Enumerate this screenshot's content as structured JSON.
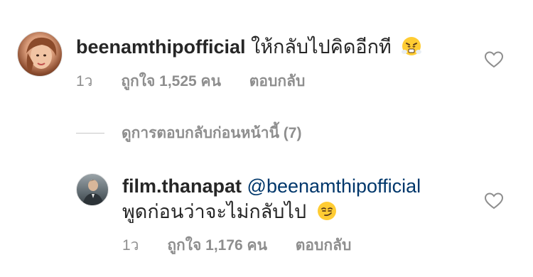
{
  "comment": {
    "username": "beenamthipofficial",
    "text": "ให้กลับไปคิดอีกที",
    "emoji": "face-with-steam-emoji",
    "time": "1ว",
    "likes": "ถูกใจ 1,525 คน",
    "reply_label": "ตอบกลับ"
  },
  "view_replies": {
    "label": "ดูการตอบกลับก่อนหน้านี้ (7)"
  },
  "reply": {
    "username": "film.thanapat",
    "mention": "@beenamthipofficial",
    "text": "พูดก่อนว่าจะไม่กลับไป",
    "emoji": "smirking-face-emoji",
    "time": "1ว",
    "likes": "ถูกใจ 1,176 คน",
    "reply_label": "ตอบกลับ"
  },
  "colors": {
    "text": "#262626",
    "secondary": "#8e8e8e",
    "mention": "#00376b"
  }
}
